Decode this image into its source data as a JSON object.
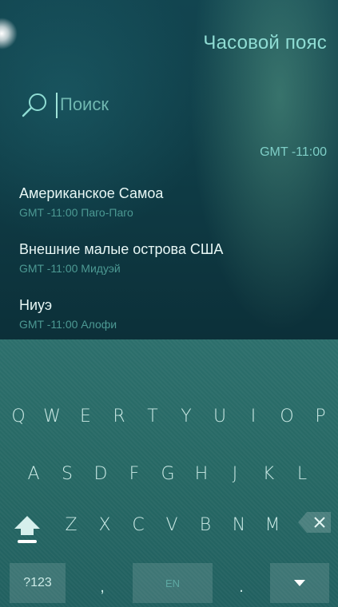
{
  "header": {
    "title": "Часовой пояс"
  },
  "search": {
    "placeholder": "Поиск",
    "value": ""
  },
  "section": {
    "header": "GMT -11:00"
  },
  "timezones": [
    {
      "name": "Американское Самоа",
      "detail": "GMT -11:00 Паго-Паго"
    },
    {
      "name": "Внешние малые острова США",
      "detail": "GMT -11:00 Мидуэй"
    },
    {
      "name": "Ниуэ",
      "detail": "GMT -11:00 Алофи"
    }
  ],
  "keyboard": {
    "row1": [
      "Q",
      "W",
      "E",
      "R",
      "T",
      "Y",
      "U",
      "I",
      "O",
      "P"
    ],
    "row2": [
      "A",
      "S",
      "D",
      "F",
      "G",
      "H",
      "J",
      "K",
      "L"
    ],
    "row3": [
      "Z",
      "X",
      "C",
      "V",
      "B",
      "N",
      "M"
    ],
    "symbols_label": "?123",
    "comma_label": ",",
    "space_label": "EN",
    "period_label": ".",
    "icons": {
      "shift": "shift-icon",
      "backspace": "backspace-icon",
      "hide": "chevron-down-icon"
    }
  },
  "colors": {
    "accent": "#8fdcd3",
    "keyboard": "#2a6b68",
    "background": "#0f3b45"
  }
}
